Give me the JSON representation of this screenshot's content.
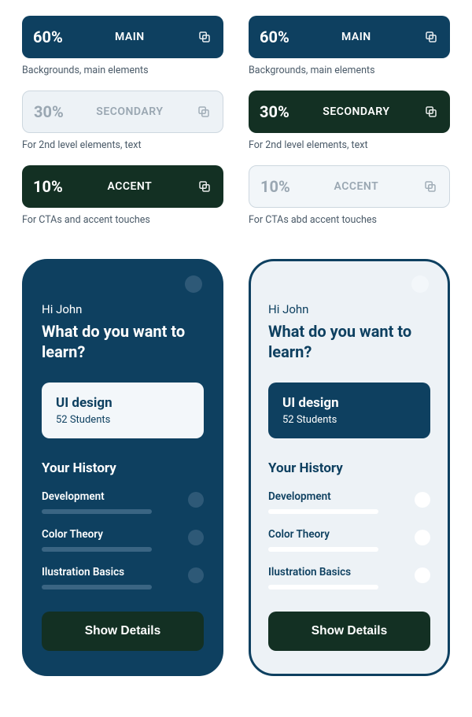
{
  "palette": {
    "main": {
      "pct": "60%",
      "label": "MAIN",
      "caption": "Backgrounds, main elements"
    },
    "sec": {
      "pct": "30%",
      "label": "SECONDARY",
      "caption": "For 2nd level elements, text"
    },
    "accL": {
      "pct": "10%",
      "label": "ACCENT",
      "caption": "For CTAs and accent touches"
    },
    "accR": {
      "pct": "10%",
      "label": "ACCENT",
      "caption": "For CTAs abd accent touches"
    }
  },
  "mock": {
    "greeting": "Hi John",
    "headline": "What do you want to learn?",
    "course": {
      "title": "UI design",
      "subtitle": "52 Students"
    },
    "historyTitle": "Your History",
    "history": [
      {
        "name": "Development"
      },
      {
        "name": "Color Theory"
      },
      {
        "name": "Ilustration Basics"
      }
    ],
    "cta": "Show Details"
  }
}
